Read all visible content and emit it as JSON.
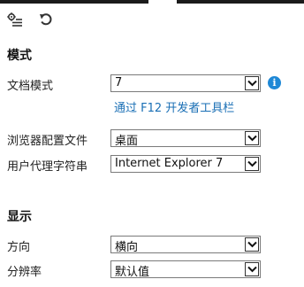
{
  "toolbar": {
    "settings_icon": "gear-list-icon",
    "undo_icon": "undo-icon"
  },
  "mode_section": {
    "title": "模式",
    "document_mode": {
      "label": "文档模式",
      "value": "7"
    },
    "info_icon_glyph": "i",
    "f12_link": "通过 F12 开发者工具栏",
    "browser_profile": {
      "label": "浏览器配置文件",
      "value": "桌面"
    },
    "user_agent": {
      "label": "用户代理字符串",
      "value": "Internet Explorer 7"
    }
  },
  "display_section": {
    "title": "显示",
    "orientation": {
      "label": "方向",
      "value": "横向"
    },
    "resolution": {
      "label": "分辨率",
      "value": "默认值"
    }
  },
  "colors": {
    "link": "#1a6fb5",
    "info": "#1e88d6"
  }
}
